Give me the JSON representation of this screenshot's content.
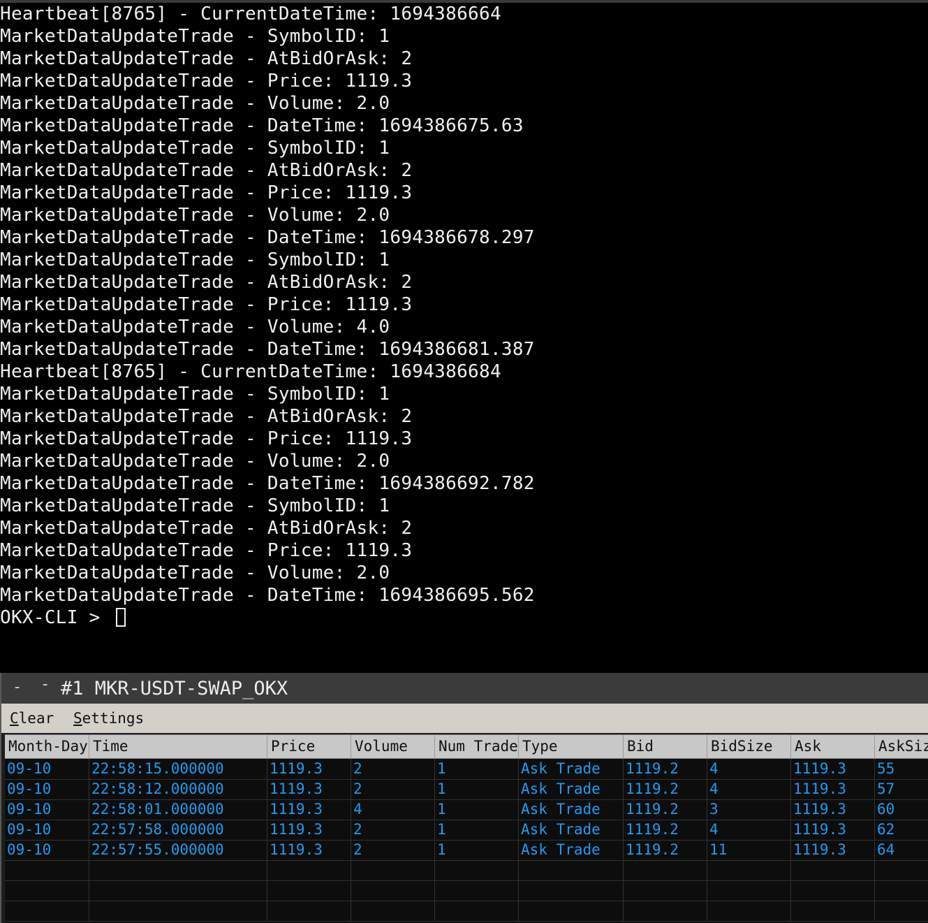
{
  "terminal": {
    "lines": [
      "Heartbeat[8765] - CurrentDateTime: 1694386664",
      "MarketDataUpdateTrade - SymbolID: 1",
      "MarketDataUpdateTrade - AtBidOrAsk: 2",
      "MarketDataUpdateTrade - Price: 1119.3",
      "MarketDataUpdateTrade - Volume: 2.0",
      "MarketDataUpdateTrade - DateTime: 1694386675.63",
      "MarketDataUpdateTrade - SymbolID: 1",
      "MarketDataUpdateTrade - AtBidOrAsk: 2",
      "MarketDataUpdateTrade - Price: 1119.3",
      "MarketDataUpdateTrade - Volume: 2.0",
      "MarketDataUpdateTrade - DateTime: 1694386678.297",
      "MarketDataUpdateTrade - SymbolID: 1",
      "MarketDataUpdateTrade - AtBidOrAsk: 2",
      "MarketDataUpdateTrade - Price: 1119.3",
      "MarketDataUpdateTrade - Volume: 4.0",
      "MarketDataUpdateTrade - DateTime: 1694386681.387",
      "Heartbeat[8765] - CurrentDateTime: 1694386684",
      "MarketDataUpdateTrade - SymbolID: 1",
      "MarketDataUpdateTrade - AtBidOrAsk: 2",
      "MarketDataUpdateTrade - Price: 1119.3",
      "MarketDataUpdateTrade - Volume: 2.0",
      "MarketDataUpdateTrade - DateTime: 1694386692.782",
      "MarketDataUpdateTrade - SymbolID: 1",
      "MarketDataUpdateTrade - AtBidOrAsk: 2",
      "MarketDataUpdateTrade - Price: 1119.3",
      "MarketDataUpdateTrade - Volume: 2.0",
      "MarketDataUpdateTrade - DateTime: 1694386695.562"
    ],
    "prompt": "OKX-CLI > "
  },
  "window": {
    "title_btn_1": "-",
    "title_btn_2": "-",
    "title": "#1 MKR-USDT-SWAP_OKX",
    "menu": {
      "clear_first": "C",
      "clear_rest": "lear",
      "settings_first": "S",
      "settings_rest": "ettings"
    },
    "columns": [
      "Month-Day",
      "Time",
      "Price",
      "Volume",
      "Num Trade",
      "Type",
      "Bid",
      "BidSize",
      "Ask",
      "AskSize"
    ],
    "rows": [
      [
        "09-10",
        "22:58:15.000000",
        "1119.3",
        "2",
        "1",
        "Ask Trade",
        "1119.2",
        "4",
        "1119.3",
        "55"
      ],
      [
        "09-10",
        "22:58:12.000000",
        "1119.3",
        "2",
        "1",
        "Ask Trade",
        "1119.2",
        "4",
        "1119.3",
        "57"
      ],
      [
        "09-10",
        "22:58:01.000000",
        "1119.3",
        "4",
        "1",
        "Ask Trade",
        "1119.2",
        "3",
        "1119.3",
        "60"
      ],
      [
        "09-10",
        "22:57:58.000000",
        "1119.3",
        "2",
        "1",
        "Ask Trade",
        "1119.2",
        "4",
        "1119.3",
        "62"
      ],
      [
        "09-10",
        "22:57:55.000000",
        "1119.3",
        "2",
        "1",
        "Ask Trade",
        "1119.2",
        "11",
        "1119.3",
        "64"
      ]
    ]
  },
  "colors": {
    "terminal_bg": "#000000",
    "terminal_text": "#f0f0f0",
    "grid_text": "#1f9bf0",
    "grid_header_bg": "#c8c8c8",
    "menubar_bg": "#d4d0c8"
  }
}
